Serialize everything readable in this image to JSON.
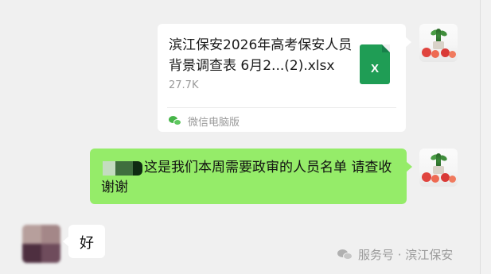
{
  "messages": {
    "file_card": {
      "file_name": "滨江保安2026年高考保安人员背景调查表  6月2...(2).xlsx",
      "file_size": "27.7K",
      "file_type_icon": "excel-icon",
      "file_type_letter": "X",
      "source_label": "微信电脑版",
      "source_icon": "wechat-icon"
    },
    "outgoing_text": "这是我们本周需要政审的人员名单  请查收 谢谢",
    "incoming_text": "好"
  },
  "watermark": {
    "text": "服务号 · 滨江保安",
    "icon": "wechat-icon"
  },
  "colors": {
    "background": "#f0f0f0",
    "sent_bubble": "#95ec69",
    "received_bubble": "#ffffff",
    "excel_green": "#1f9d55"
  }
}
